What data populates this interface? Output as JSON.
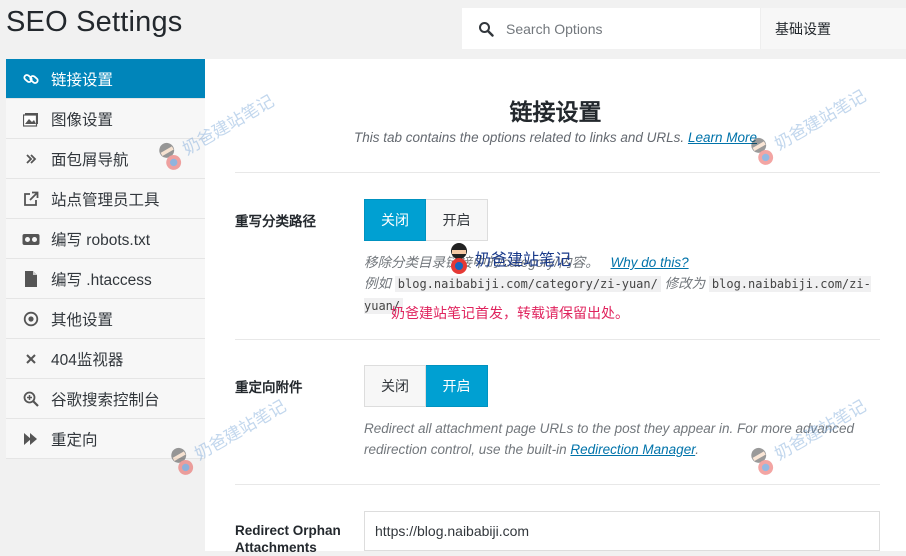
{
  "page_title": "SEO Settings",
  "search": {
    "placeholder": "Search Options"
  },
  "section_select": {
    "value": "基础设置"
  },
  "sidebar": {
    "items": [
      {
        "label": "链接设置",
        "icon": "link-icon",
        "active": true
      },
      {
        "label": "图像设置",
        "icon": "image-icon"
      },
      {
        "label": "面包屑导航",
        "icon": "double-chevron-icon"
      },
      {
        "label": "站点管理员工具",
        "icon": "external-link-icon"
      },
      {
        "label": "编写 robots.txt",
        "icon": "robot-icon"
      },
      {
        "label": "编写 .htaccess",
        "icon": "file-icon"
      },
      {
        "label": "其他设置",
        "icon": "circle-dot-icon"
      },
      {
        "label": "404监视器",
        "icon": "close-icon"
      },
      {
        "label": "谷歌搜索控制台",
        "icon": "zoom-icon"
      },
      {
        "label": "重定向",
        "icon": "fast-forward-icon"
      }
    ]
  },
  "main": {
    "title": "链接设置",
    "description": "This tab contains the options related to links and URLs.",
    "learn_more": "Learn More",
    "strip_category": {
      "label": "重写分类路径",
      "off": "关闭",
      "on": "开启",
      "selected": "off",
      "help_line1": "移除分类目录链接中的/category/内容。",
      "why_link": "Why do this?",
      "help_example_prefix": "例如",
      "help_example_from": "blog.naibabiji.com/category/zi-yuan/",
      "help_example_mid": "修改为",
      "help_example_to": "blog.naibabiji.com/zi-yuan/",
      "watermark_text": "奶爸建站笔记",
      "red_note": "奶爸建站笔记首发，转载请保留出处。"
    },
    "redirect_attachments": {
      "label": "重定向附件",
      "off": "关闭",
      "on": "开启",
      "selected": "on",
      "help_line1": "Redirect all attachment page URLs to the post they appear in. For more advanced",
      "help_line2_prefix": "redirection control, use the built-in",
      "redirection_manager_link": "Redirection Manager",
      "help_line2_suffix": "."
    },
    "redirect_orphan": {
      "label_line1": "Redirect Orphan",
      "label_line2": "Attachments",
      "value": "https://blog.naibabiji.com"
    }
  },
  "watermark": {
    "text": "奶爸建站笔记"
  },
  "colors": {
    "accent": "#0085ba",
    "toggle_on": "#00a0d2",
    "link": "#0073aa",
    "red_note": "#e0245e"
  }
}
